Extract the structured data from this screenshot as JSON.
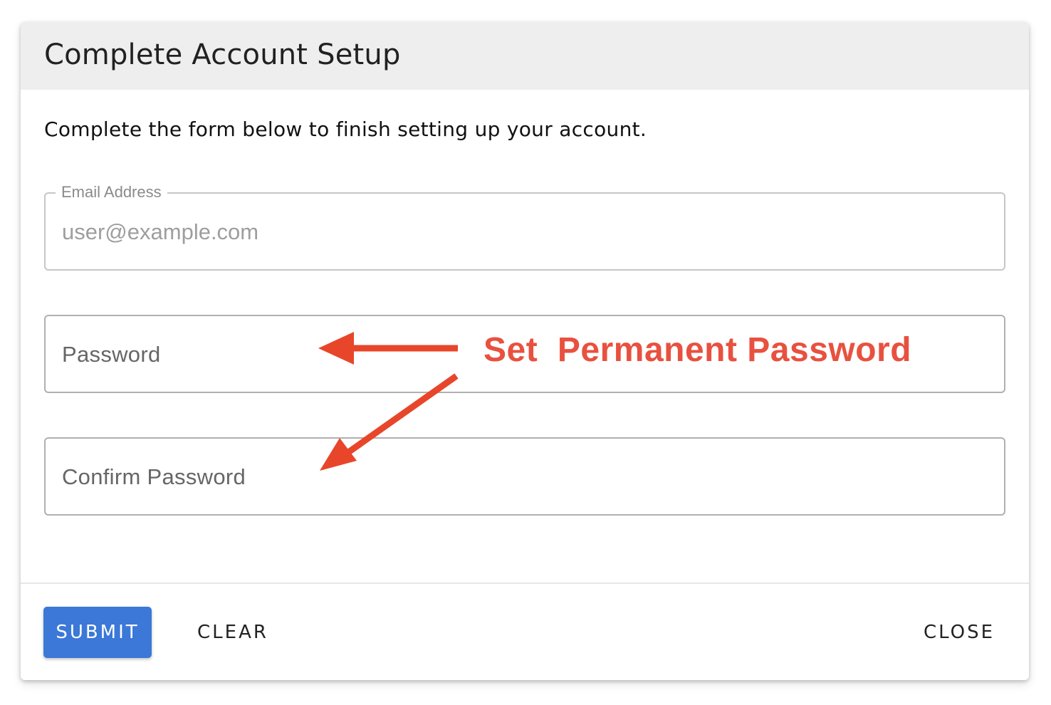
{
  "dialog": {
    "title": "Complete Account Setup",
    "intro": "Complete the form below to finish setting up your account."
  },
  "form": {
    "email": {
      "label": "Email Address",
      "value": "user@example.com"
    },
    "password": {
      "label": "Password"
    },
    "confirm_password": {
      "label": "Confirm Password"
    }
  },
  "annotation": {
    "text": "Set  Permanent Password",
    "color": "#e8513f"
  },
  "actions": {
    "submit_label": "SUBMIT",
    "clear_label": "CLEAR",
    "close_label": "CLOSE"
  },
  "colors": {
    "primary": "#3b78d8",
    "header_bg": "#eeeeee",
    "annotation": "#e8513f"
  }
}
